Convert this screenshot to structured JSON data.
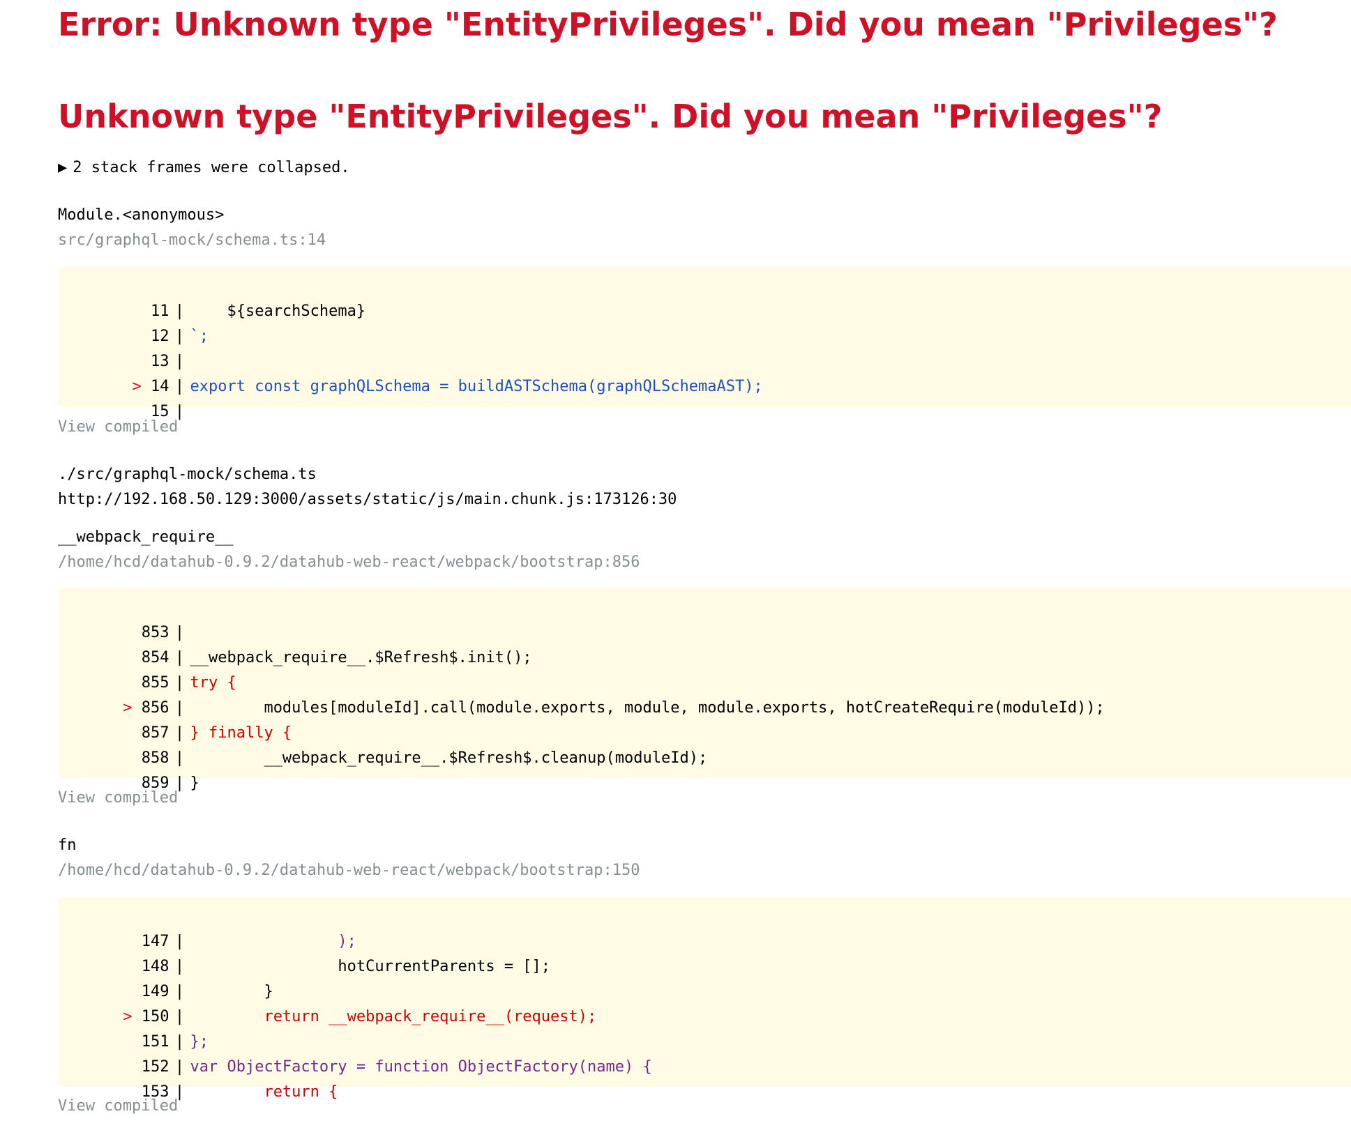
{
  "error": {
    "title": "Error: Unknown type \"EntityPrivileges\". Did you mean \"Privileges\"?",
    "message": "Unknown type \"EntityPrivileges\". Did you mean \"Privileges\"?"
  },
  "collapsed": {
    "icon": "▶",
    "text": "2 stack frames were collapsed."
  },
  "frames": [
    {
      "name": "Module.<anonymous>",
      "location": "src/graphql-mock/schema.ts:14",
      "lines": [
        {
          "num": "11",
          "code": "    ${searchSchema}"
        },
        {
          "num": "12",
          "code": "`;"
        },
        {
          "num": "13",
          "code": ""
        },
        {
          "num": "14",
          "code": "export const graphQLSchema = buildASTSchema(graphQLSchemaAST);",
          "highlight": true
        },
        {
          "num": "15",
          "code": ""
        }
      ],
      "view_compiled": "View compiled"
    },
    {
      "name": "./src/graphql-mock/schema.ts",
      "location": "http://192.168.50.129:3000/assets/static/js/main.chunk.js:173126:30"
    },
    {
      "name": "__webpack_require__",
      "location": "/home/hcd/datahub-0.9.2/datahub-web-react/webpack/bootstrap:856",
      "lines": [
        {
          "num": "853",
          "code": ""
        },
        {
          "num": "854",
          "code": "__webpack_require__.$Refresh$.init();"
        },
        {
          "num": "855",
          "code": "try {"
        },
        {
          "num": "856",
          "code": "        modules[moduleId].call(module.exports, module, module.exports, hotCreateRequire(moduleId));",
          "highlight": true
        },
        {
          "num": "857",
          "code": "} finally {"
        },
        {
          "num": "858",
          "code": "        __webpack_require__.$Refresh$.cleanup(moduleId);"
        },
        {
          "num": "859",
          "code": "}"
        }
      ],
      "view_compiled": "View compiled"
    },
    {
      "name": "fn",
      "location": "/home/hcd/datahub-0.9.2/datahub-web-react/webpack/bootstrap:150",
      "lines": [
        {
          "num": "147",
          "code": "                );"
        },
        {
          "num": "148",
          "code": "                hotCurrentParents = [];"
        },
        {
          "num": "149",
          "code": "        }"
        },
        {
          "num": "150",
          "code": "        return __webpack_require__(request);",
          "highlight": true
        },
        {
          "num": "151",
          "code": "};"
        },
        {
          "num": "152",
          "code": "var ObjectFactory = function ObjectFactory(name) {"
        },
        {
          "num": "153",
          "code": "        return {"
        }
      ],
      "view_compiled": "View compiled"
    }
  ],
  "colors": {
    "error_red": "#ce1126",
    "code_bg": "#fffbe5",
    "muted": "#878e91"
  }
}
